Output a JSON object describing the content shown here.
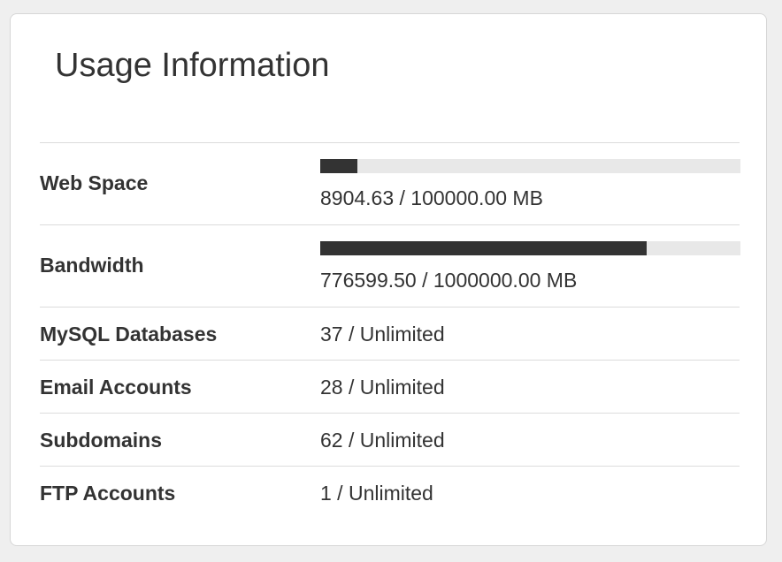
{
  "card": {
    "title": "Usage Information"
  },
  "usage": {
    "web_space": {
      "label": "Web Space",
      "value": "8904.63 / 100000.00 MB",
      "used": 8904.63,
      "limit": 100000.0
    },
    "bandwidth": {
      "label": "Bandwidth",
      "value": "776599.50 / 1000000.00 MB",
      "used": 776599.5,
      "limit": 1000000.0
    },
    "mysql": {
      "label": "MySQL Databases",
      "value": "37 / Unlimited"
    },
    "email": {
      "label": "Email Accounts",
      "value": "28 / Unlimited"
    },
    "subdomains": {
      "label": "Subdomains",
      "value": "62 / Unlimited"
    },
    "ftp": {
      "label": "FTP Accounts",
      "value": "1 / Unlimited"
    }
  },
  "colors": {
    "bar_fill": "#333333",
    "bar_track": "#e8e8e8"
  }
}
